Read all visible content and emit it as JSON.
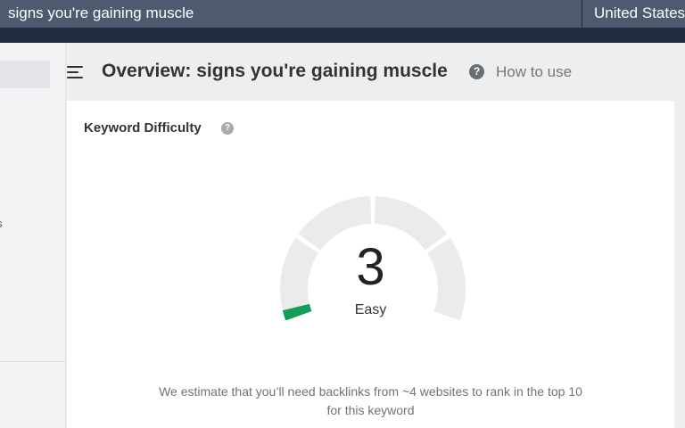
{
  "topbar": {
    "search_value": "signs you're gaining muscle",
    "country": "United States"
  },
  "sidebar": {
    "partial_label": "s"
  },
  "header": {
    "title": "Overview: signs you're gaining muscle",
    "help_symbol": "?",
    "how_to_use": "How to use"
  },
  "card": {
    "title": "Keyword Difficulty",
    "info_symbol": "?",
    "score": "3",
    "score_value": 3,
    "score_max": 100,
    "rating": "Easy",
    "estimate_line1": "We estimate that you’ll need backlinks from ~4 websites to rank in the top 10",
    "estimate_line2": "for this keyword"
  },
  "colors": {
    "topbar_bg": "#1f2b3e",
    "search_bg": "#4f5a70",
    "gauge_track": "#ebebeb",
    "gauge_fill": "#149c58"
  }
}
